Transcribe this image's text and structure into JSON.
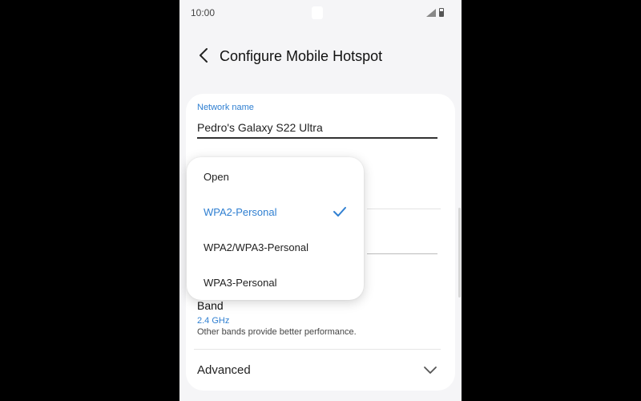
{
  "status_bar": {
    "time": "10:00",
    "icons": [
      "signal-icon",
      "battery-icon"
    ]
  },
  "header": {
    "back_icon": "chevron-left-icon",
    "title": "Configure Mobile Hotspot"
  },
  "network_name": {
    "label": "Network name",
    "value": "Pedro's Galaxy S22 Ultra"
  },
  "security_dropdown": {
    "options": [
      {
        "label": "Open",
        "selected": false
      },
      {
        "label": "WPA2-Personal",
        "selected": true
      },
      {
        "label": "WPA2/WPA3-Personal",
        "selected": false
      },
      {
        "label": "WPA3-Personal",
        "selected": false
      }
    ],
    "selected_icon": "checkmark-icon"
  },
  "band": {
    "title": "Band",
    "value": "2.4 GHz",
    "description": "Other bands provide better performance."
  },
  "advanced": {
    "label": "Advanced",
    "icon": "chevron-down-icon"
  },
  "colors": {
    "accent": "#2f7fd1",
    "background": "#f5f5f7",
    "card": "#ffffff",
    "text": "#222222"
  }
}
